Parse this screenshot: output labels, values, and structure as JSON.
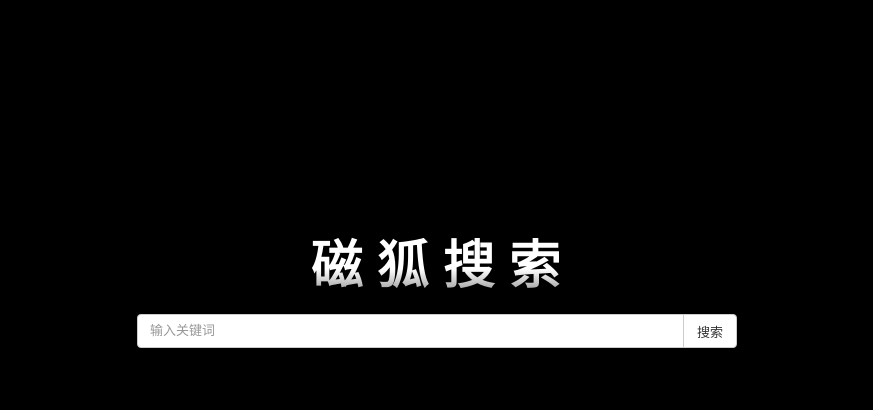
{
  "logo": {
    "text": "磁狐搜索"
  },
  "search": {
    "placeholder": "输入关键词",
    "value": "",
    "button_label": "搜索"
  },
  "colors": {
    "background": "#000000",
    "logo": "#ffffff",
    "input_border": "#cccccc",
    "placeholder": "#999999"
  }
}
